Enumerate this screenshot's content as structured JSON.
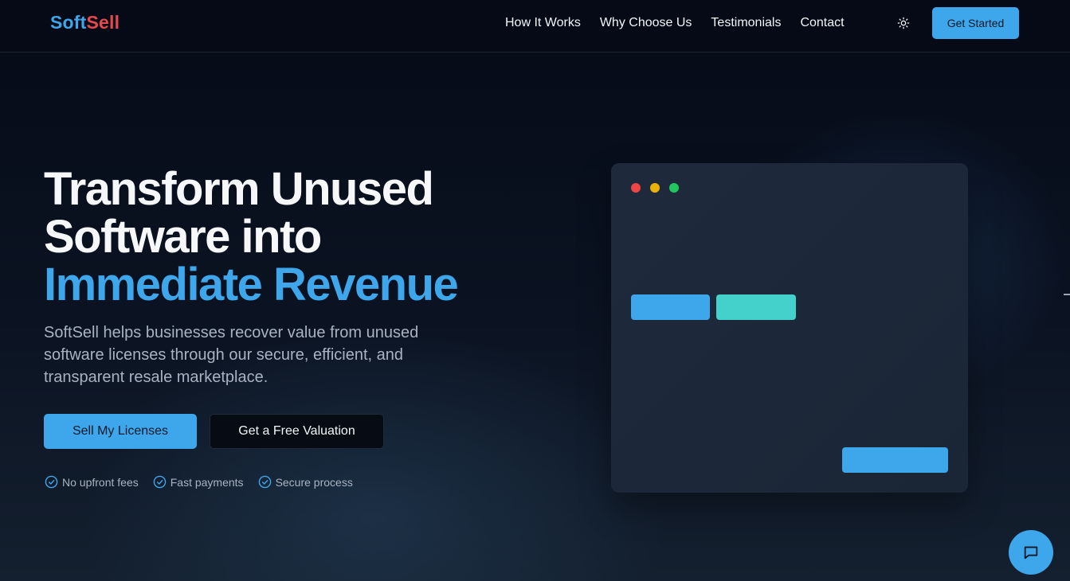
{
  "header": {
    "logo_part1": "Soft",
    "logo_part2": "Sell",
    "nav": [
      {
        "label": "How It Works"
      },
      {
        "label": "Why Choose Us"
      },
      {
        "label": "Testimonials"
      },
      {
        "label": "Contact"
      }
    ],
    "theme_icon": "sun-icon",
    "cta_label": "Get Started"
  },
  "hero": {
    "title_line1": "Transform Unused",
    "title_line2": "Software into",
    "title_accent": "Immediate Revenue",
    "subtitle": "SoftSell helps businesses recover value from unused software licenses through our secure, efficient, and transparent resale marketplace.",
    "primary_button": "Sell My Licenses",
    "secondary_button": "Get a Free Valuation",
    "features": [
      {
        "label": "No upfront fees",
        "icon": "check-circle-icon"
      },
      {
        "label": "Fast payments",
        "icon": "check-circle-icon"
      },
      {
        "label": "Secure process",
        "icon": "check-circle-icon"
      }
    ]
  },
  "chat": {
    "icon": "chat-icon"
  },
  "colors": {
    "accent": "#3ea6ea",
    "brand_red": "#e5484d",
    "teal": "#44d1cc",
    "background": "#050a16",
    "card": "#1e2a3c"
  }
}
